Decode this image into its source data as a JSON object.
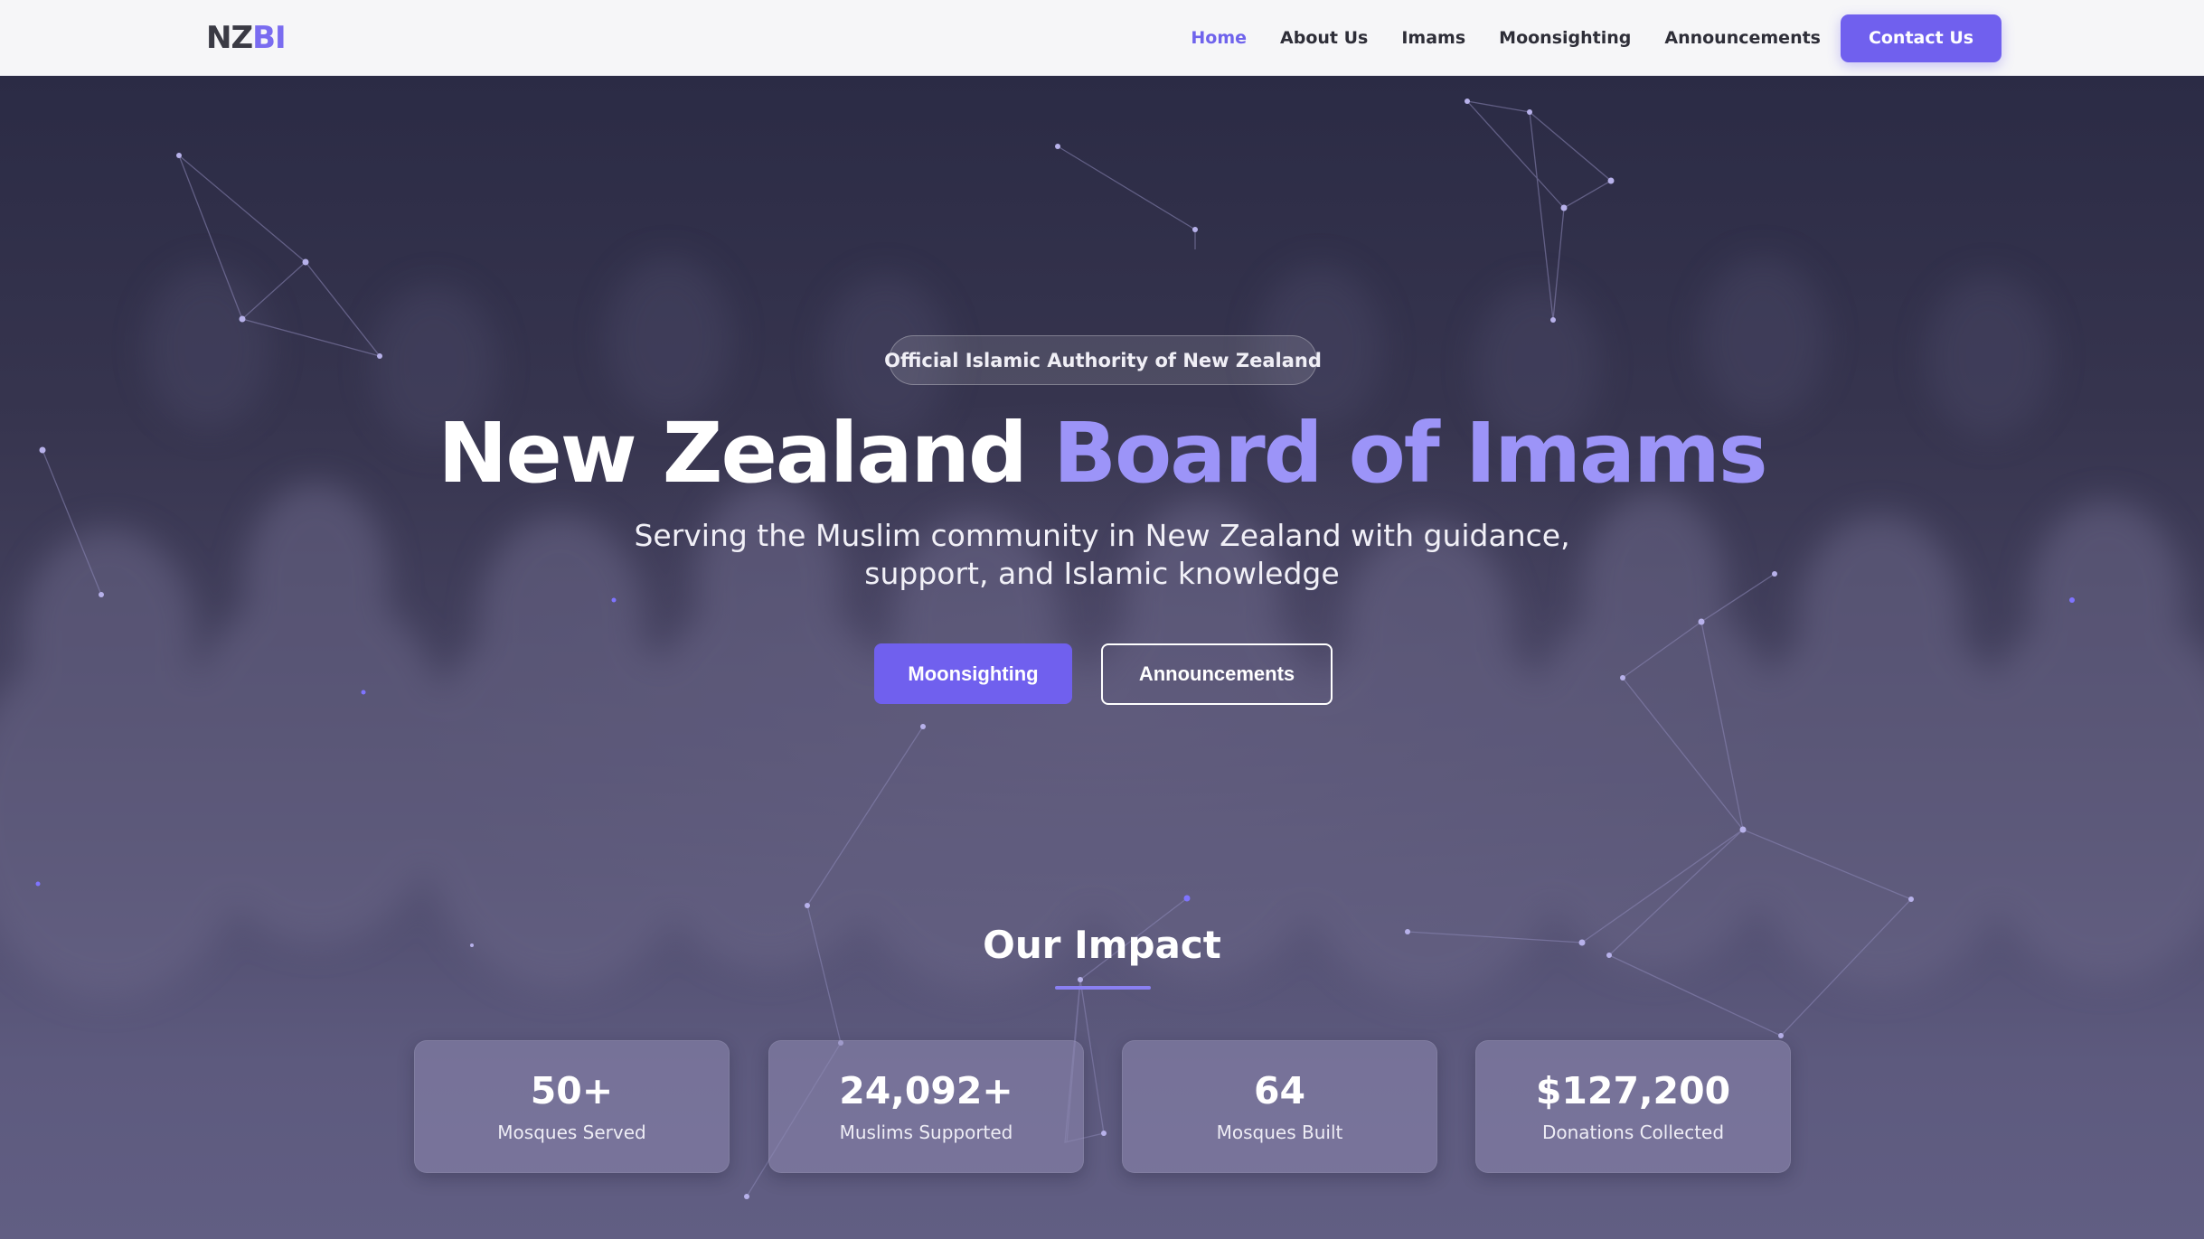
{
  "brand": {
    "logo_part1": "NZ",
    "logo_part2": "BI"
  },
  "nav": {
    "links": [
      {
        "label": "Home",
        "active": true
      },
      {
        "label": "About Us"
      },
      {
        "label": "Imams"
      },
      {
        "label": "Moonsighting"
      },
      {
        "label": "Announcements"
      }
    ],
    "contact_label": "Contact Us"
  },
  "hero": {
    "badge": "Official Islamic Authority of New Zealand",
    "title_white": "New Zealand",
    "title_accent": "Board of Imams",
    "subtitle_line1": "Serving the Muslim community in New Zealand with guidance,",
    "subtitle_line2": "support, and Islamic knowledge",
    "primary_button": "Moonsighting",
    "secondary_button": "Announcements"
  },
  "impact": {
    "title": "Our Impact",
    "stats": [
      {
        "value": "50+",
        "label": "Mosques Served"
      },
      {
        "value": "24,092+",
        "label": "Muslims Supported"
      },
      {
        "value": "64",
        "label": "Mosques Built"
      },
      {
        "value": "$127,200",
        "label": "Donations Collected"
      }
    ]
  },
  "colors": {
    "accent": "#7060ee",
    "accent_light": "#9c94f8",
    "nav_background": "#f6f6f8",
    "hero_dark": "#2b2b45"
  }
}
